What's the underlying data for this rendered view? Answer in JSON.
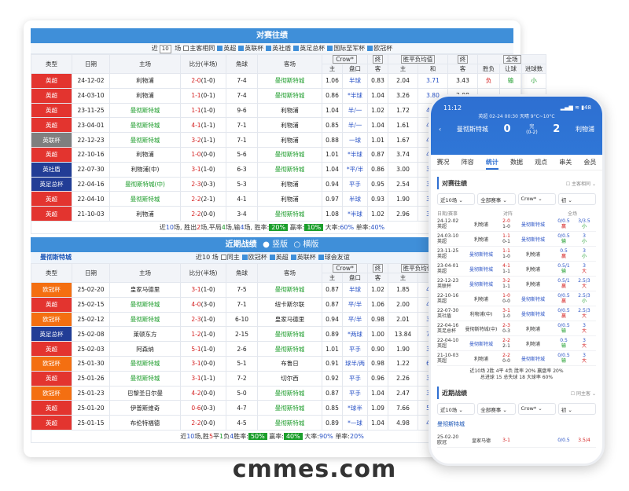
{
  "h2h": {
    "title": "对赛往绩",
    "filter": {
      "prefix": "近",
      "count": "10",
      "suffix": "场",
      "checks": [
        {
          "label": "主客相同",
          "on": false
        },
        {
          "label": "英超",
          "on": true
        },
        {
          "label": "英联杯",
          "on": true
        },
        {
          "label": "英社盾",
          "on": true
        },
        {
          "label": "英足总杯",
          "on": true
        },
        {
          "label": "国际至军杯",
          "on": true
        },
        {
          "label": "欧冠杯",
          "on": true
        }
      ]
    },
    "headers": {
      "type": "类型",
      "date": "日期",
      "home": "主场",
      "score": "比分(半场)",
      "corner": "角球",
      "away": "客场",
      "company": "Crow*",
      "settle": "终",
      "odds_type": "胜平负均值",
      "settle2": "终",
      "all": "全场",
      "sub": [
        "主",
        "盘口",
        "客",
        "主",
        "和",
        "客",
        "胜负",
        "让球",
        "进球数"
      ]
    },
    "rows": [
      {
        "type": "英超",
        "c": "red",
        "date": "24-12-02",
        "home": "利物浦",
        "hg": false,
        "score": "2-0",
        "half": "(1-0)",
        "corner": "7-4",
        "away": "曼彻斯特城",
        "ag": true,
        "o1": "1.06",
        "hc": "半球",
        "o2": "0.83",
        "w": "2.04",
        "d": "3.71",
        "l": "3.43",
        "r1": "负",
        "r2": "输",
        "r3": "小"
      },
      {
        "type": "英超",
        "c": "red",
        "date": "24-03-10",
        "home": "利物浦",
        "hg": false,
        "score": "1-1",
        "half": "(0-1)",
        "corner": "7-4",
        "away": "曼彻斯特城",
        "ag": true,
        "o1": "0.86",
        "hc": "*半球",
        "o2": "1.04",
        "w": "3.26",
        "d": "3.80",
        "l": "2.08",
        "r1": "",
        "r2": "",
        "r3": ""
      },
      {
        "type": "英超",
        "c": "red",
        "date": "23-11-25",
        "home": "曼彻斯特城",
        "hg": true,
        "score": "1-1",
        "half": "(1-0)",
        "corner": "9-6",
        "away": "利物浦",
        "ag": false,
        "o1": "1.04",
        "hc": "半/一",
        "o2": "1.02",
        "w": "1.72",
        "d": "4.22",
        "l": "4.61",
        "r1": "",
        "r2": "",
        "r3": ""
      },
      {
        "type": "英超",
        "c": "red",
        "date": "23-04-01",
        "home": "曼彻斯特城",
        "hg": true,
        "score": "4-1",
        "half": "(1-1)",
        "corner": "7-1",
        "away": "利物浦",
        "ag": false,
        "o1": "0.85",
        "hc": "半/一",
        "o2": "1.04",
        "w": "1.61",
        "d": "4.23",
        "l": "5.33",
        "r1": "",
        "r2": "",
        "r3": ""
      },
      {
        "type": "英联杯",
        "c": "gray",
        "date": "22-12-23",
        "home": "曼彻斯特城",
        "hg": true,
        "score": "3-2",
        "half": "(1-1)",
        "corner": "7-1",
        "away": "利物浦",
        "ag": false,
        "o1": "0.88",
        "hc": "一球",
        "o2": "1.01",
        "w": "1.67",
        "d": "4.19",
        "l": "4.64",
        "r1": "",
        "r2": "",
        "r3": ""
      },
      {
        "type": "英超",
        "c": "red",
        "date": "22-10-16",
        "home": "利物浦",
        "hg": false,
        "score": "1-0",
        "half": "(0-0)",
        "corner": "5-6",
        "away": "曼彻斯特城",
        "ag": true,
        "o1": "1.01",
        "hc": "*半球",
        "o2": "0.87",
        "w": "3.74",
        "d": "4.07",
        "l": "1.88",
        "r1": "",
        "r2": "",
        "r3": ""
      },
      {
        "type": "英社盾",
        "c": "navy",
        "date": "22-07-30",
        "home": "利物浦(中)",
        "hg": false,
        "score": "3-1",
        "half": "(1-0)",
        "corner": "6-3",
        "away": "曼彻斯特城",
        "ag": true,
        "o1": "1.04",
        "hc": "*平/半",
        "o2": "0.86",
        "w": "3.00",
        "d": "3.53",
        "l": "2.33",
        "r1": "",
        "r2": "",
        "r3": ""
      },
      {
        "type": "英足总杯",
        "c": "navy",
        "date": "22-04-16",
        "home": "曼彻斯特城(中)",
        "hg": true,
        "score": "2-3",
        "half": "(0-3)",
        "corner": "5-3",
        "away": "利物浦",
        "ag": false,
        "o1": "0.94",
        "hc": "平手",
        "o2": "0.95",
        "w": "2.54",
        "d": "3.38",
        "l": "2.78",
        "r1": "",
        "r2": "",
        "r3": ""
      },
      {
        "type": "英超",
        "c": "red",
        "date": "22-04-10",
        "home": "曼彻斯特城",
        "hg": true,
        "score": "2-2",
        "half": "(2-1)",
        "corner": "4-1",
        "away": "利物浦",
        "ag": false,
        "o1": "0.97",
        "hc": "半球",
        "o2": "0.93",
        "w": "1.90",
        "d": "3.67",
        "l": "3.90",
        "r1": "",
        "r2": "",
        "r3": ""
      },
      {
        "type": "英超",
        "c": "red",
        "date": "21-10-03",
        "home": "利物浦",
        "hg": false,
        "score": "2-2",
        "half": "(0-0)",
        "corner": "3-4",
        "away": "曼彻斯特城",
        "ag": true,
        "o1": "1.08",
        "hc": "*半球",
        "o2": "1.02",
        "w": "2.96",
        "d": "3.54",
        "l": "2.33",
        "r1": "",
        "r2": "",
        "r3": ""
      }
    ],
    "summary": {
      "t1": "近",
      "n": "10",
      "t2": "场, 胜出",
      "w": "2",
      "t3": "场,平局",
      "d": "4",
      "t4": "场,输",
      "l": "4",
      "t5": "场, 胜率:",
      "wr": "20%",
      "t6": "赢率:",
      "yr": "10%",
      "t7": "大率:",
      "big": "60%",
      "t8": "单率:",
      "odd": "40%"
    }
  },
  "recent": {
    "title": "近期战绩",
    "opt1": "竖版",
    "opt2": "横版",
    "team": "曼彻斯特城",
    "filter": {
      "prefix": "近",
      "count": "10",
      "suffix": "场",
      "checks": [
        {
          "label": "同主",
          "on": false
        },
        {
          "label": "欧冠杯",
          "on": true
        },
        {
          "label": "英超",
          "on": true
        },
        {
          "label": "英联杯",
          "on": true
        },
        {
          "label": "球会友谊",
          "on": true
        }
      ]
    },
    "rows": [
      {
        "type": "欧冠杯",
        "c": "orange",
        "date": "25-02-20",
        "home": "皇家马德里",
        "score": "3-1",
        "half": "(1-0)",
        "corner": "7-5",
        "away": "曼彻斯特城",
        "o1": "0.87",
        "hc": "半球",
        "o2": "1.02",
        "w": "1.85",
        "d": "4.23",
        "l": "3.69"
      },
      {
        "type": "英超",
        "c": "red",
        "date": "25-02-15",
        "home": "曼彻斯特城",
        "score": "4-0",
        "half": "(3-0)",
        "corner": "7-1",
        "away": "纽卡斯尔联",
        "o1": "0.87",
        "hc": "平/半",
        "o2": "1.06",
        "w": "2.00",
        "d": "4.01",
        "l": "3.32"
      },
      {
        "type": "欧冠杯",
        "c": "orange",
        "date": "25-02-12",
        "home": "曼彻斯特城",
        "score": "2-3",
        "half": "(1-0)",
        "corner": "6-10",
        "away": "皇家马德里",
        "o1": "0.94",
        "hc": "平/半",
        "o2": "0.98",
        "w": "2.01",
        "d": "3.92",
        "l": "3.39"
      },
      {
        "type": "英足总杯",
        "c": "navy",
        "date": "25-02-08",
        "home": "莱顿东方",
        "score": "1-2",
        "half": "(1-0)",
        "corner": "2-15",
        "away": "曼彻斯特城",
        "o1": "0.89",
        "hc": "*两球",
        "o2": "1.00",
        "w": "13.84",
        "d": "7.73",
        "l": "1.17"
      },
      {
        "type": "英超",
        "c": "red",
        "date": "25-02-03",
        "home": "阿森纳",
        "score": "5-1",
        "half": "(1-0)",
        "corner": "2-6",
        "away": "曼彻斯特城",
        "o1": "1.01",
        "hc": "平手",
        "o2": "0.90",
        "w": "1.90",
        "d": "3.60",
        "l": "3.36"
      },
      {
        "type": "欧冠杯",
        "c": "orange",
        "date": "25-01-30",
        "home": "曼彻斯特城",
        "score": "3-1",
        "half": "(0-0)",
        "corner": "5-1",
        "away": "布鲁日",
        "o1": "0.91",
        "hc": "球半/两",
        "o2": "0.98",
        "w": "1.22",
        "d": "6.89",
        "l": "11.64"
      },
      {
        "type": "英超",
        "c": "red",
        "date": "25-01-26",
        "home": "曼彻斯特城",
        "score": "3-1",
        "half": "(1-1)",
        "corner": "7-2",
        "away": "切尔西",
        "o1": "0.92",
        "hc": "平手",
        "o2": "0.96",
        "w": "2.26",
        "d": "3.81",
        "l": "2.93"
      },
      {
        "type": "欧冠杯",
        "c": "orange",
        "date": "25-01-23",
        "home": "巴黎圣日尔曼",
        "score": "4-2",
        "half": "(0-0)",
        "corner": "5-0",
        "away": "曼彻斯特城",
        "o1": "0.87",
        "hc": "平手",
        "o2": "1.04",
        "w": "2.47",
        "d": "3.64",
        "l": "2.66"
      },
      {
        "type": "英超",
        "c": "red",
        "date": "25-01-20",
        "home": "伊普斯维奇",
        "score": "0-6",
        "half": "(0-3)",
        "corner": "4-7",
        "away": "曼彻斯特城",
        "o1": "0.85",
        "hc": "*球半",
        "o2": "1.09",
        "w": "7.66",
        "d": "5.19",
        "l": "1.38"
      },
      {
        "type": "英超",
        "c": "red",
        "date": "25-01-15",
        "home": "布伦特福德",
        "score": "2-2",
        "half": "(0-0)",
        "corner": "4-5",
        "away": "曼彻斯特城",
        "o1": "0.89",
        "hc": "*一球",
        "o2": "1.04",
        "w": "4.98",
        "d": "4.46",
        "l": "1.62"
      }
    ],
    "summary": {
      "t1": "近",
      "n": "10",
      "t2": "场,胜",
      "w": "5",
      "t3": "平",
      "d": "1",
      "t4": "负",
      "l": "4",
      "t5": "胜率:",
      "wr": "50%",
      "t6": "赢率:",
      "yr": "40%",
      "t7": "大率:",
      "big": "90%",
      "t8": "单率:",
      "odd": "20%"
    }
  },
  "phone": {
    "time": "11:12",
    "battery": "48",
    "league_line": "英超 02-24 00:30 天晴 9°C~10°C",
    "home": "曼彻斯特城",
    "away": "利物浦",
    "hs": "0",
    "as": "2",
    "state": "完",
    "half": "(0-2)",
    "tabs": [
      "赛况",
      "阵容",
      "统计",
      "数据",
      "观点",
      "串关",
      "会员"
    ],
    "h2h_title": "对赛往绩",
    "same": "主客相同",
    "sels": [
      "近10场",
      "全部赛事",
      "Crow*",
      "初"
    ],
    "col_head": {
      "date": "日期/赛事",
      "vs": "对阵",
      "all": "全场"
    },
    "rows": [
      {
        "d": "24-12-02",
        "l": "英超",
        "h": "利物浦",
        "s": "2-0",
        "hs": "1-0",
        "a": "曼彻斯特城",
        "pan": "0/0.5",
        "r": "3/3.5",
        "win": "赢",
        "big": "小"
      },
      {
        "d": "24-03-10",
        "l": "英超",
        "h": "利物浦",
        "s": "1-1",
        "hs": "0-1",
        "a": "曼彻斯特城",
        "pan": "0/0.5",
        "r": "3",
        "win": "输",
        "big": "小"
      },
      {
        "d": "23-11-25",
        "l": "英超",
        "h": "曼彻斯特城",
        "s": "1-1",
        "hs": "1-0",
        "a": "利物浦",
        "pan": "0.5",
        "r": "3",
        "win": "赢",
        "big": "小"
      },
      {
        "d": "23-04-01",
        "l": "英超",
        "h": "曼彻斯特城",
        "s": "4-1",
        "hs": "1-1",
        "a": "利物浦",
        "pan": "0.5/1",
        "r": "3",
        "win": "输",
        "big": "大"
      },
      {
        "d": "22-12-23",
        "l": "英联杯",
        "h": "曼彻斯特城",
        "s": "3-2",
        "hs": "1-1",
        "a": "利物浦",
        "pan": "0.5/1",
        "r": "2.5/3",
        "win": "赢",
        "big": "大"
      },
      {
        "d": "22-10-16",
        "l": "英超",
        "h": "利物浦",
        "s": "1-0",
        "hs": "0-0",
        "a": "曼彻斯特城",
        "pan": "0/0.5",
        "r": "2.5/3",
        "win": "赢",
        "big": "小"
      },
      {
        "d": "22-07-30",
        "l": "英社盾",
        "h": "利物浦(中)",
        "s": "3-1",
        "hs": "1-0",
        "a": "曼彻斯特城",
        "pan": "0/0.5",
        "r": "2.5/3",
        "win": "赢",
        "big": "大"
      },
      {
        "d": "22-04-16",
        "l": "英足总杯",
        "h": "曼彻斯特城(中)",
        "s": "2-3",
        "hs": "0-3",
        "a": "利物浦",
        "pan": "0/0.5",
        "r": "3",
        "win": "输",
        "big": "大"
      },
      {
        "d": "22-04-10",
        "l": "英超",
        "h": "曼彻斯特城",
        "s": "2-2",
        "hs": "2-1",
        "a": "利物浦",
        "pan": "0.5",
        "r": "3",
        "win": "输",
        "big": "大"
      },
      {
        "d": "21-10-03",
        "l": "英超",
        "h": "利物浦",
        "s": "2-2",
        "hs": "0-0",
        "a": "曼彻斯特城",
        "pan": "0/0.5",
        "r": "3",
        "win": "输",
        "big": "大"
      }
    ],
    "sum1": "近10场 2胜 4平 4负 胜率 20% 赢盘率 20%",
    "sum2": "总进球 15 总失球 18 大球率 60%",
    "recent_title": "近期战绩",
    "same2": "同主客",
    "sels2": [
      "近10场",
      "全部赛事",
      "Crow*",
      "初"
    ],
    "team": "曼彻斯特城",
    "last": {
      "d": "25-02-20",
      "l": "欧冠",
      "h": "皇家马德",
      "s": "3-1",
      "a": "",
      "pan": "0/0.5",
      "r": "3.5/4"
    }
  },
  "watermark": "cmmes.com"
}
